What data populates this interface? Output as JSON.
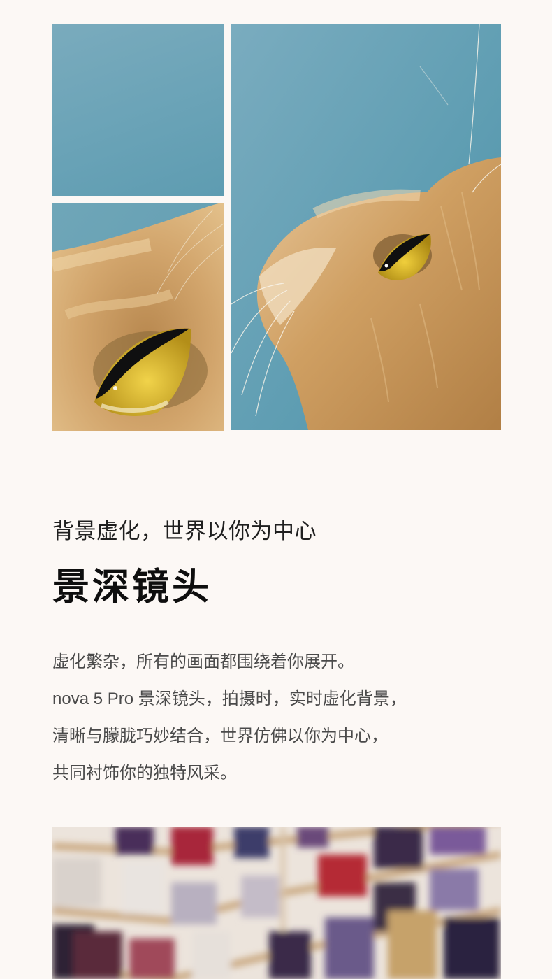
{
  "feature": {
    "subtitle": "背景虚化，世界以你为中心",
    "title": "景深镜头",
    "description_lines": [
      "虚化繁杂，所有的画面都围绕着你展开。",
      "nova 5 Pro 景深镜头，拍摄时，实时虚化背景，",
      "清晰与朦胧巧妙结合，世界仿佛以你为中心，",
      "共同衬饰你的独特风采。"
    ]
  },
  "images": {
    "collage_top_left": "blurred-blue-background",
    "collage_bottom_left": "cat-eye-closeup",
    "collage_right": "cat-looking-up",
    "bottom": "blurred-record-wall"
  },
  "colors": {
    "page_background": "#fcf8f5",
    "backdrop_blue": "#6aa3b7",
    "cat_fur": "#c89660",
    "eye_yellow": "#d9b52a",
    "title_text": "#0e0e0e",
    "body_text": "#4a4a4a"
  }
}
